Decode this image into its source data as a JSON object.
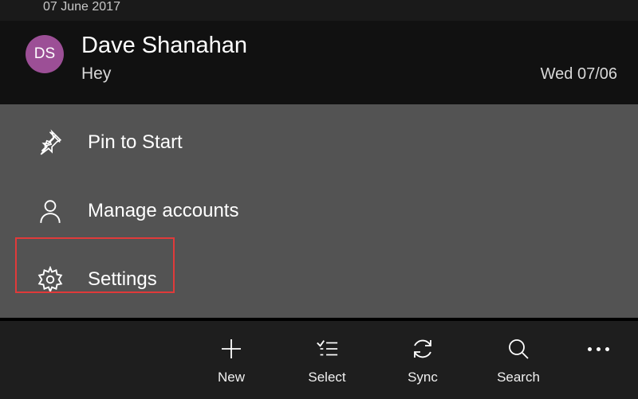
{
  "header": {
    "date_group": "07 June 2017"
  },
  "email": {
    "avatar_initials": "DS",
    "sender": "Dave Shanahan",
    "preview": "Hey",
    "date": "Wed 07/06"
  },
  "menu": {
    "pin_label": "Pin to Start",
    "manage_label": "Manage accounts",
    "settings_label": "Settings"
  },
  "bottombar": {
    "new": "New",
    "select": "Select",
    "sync": "Sync",
    "search": "Search"
  },
  "colors": {
    "avatar_bg": "#9c4f96",
    "highlight": "#e03a3a"
  }
}
